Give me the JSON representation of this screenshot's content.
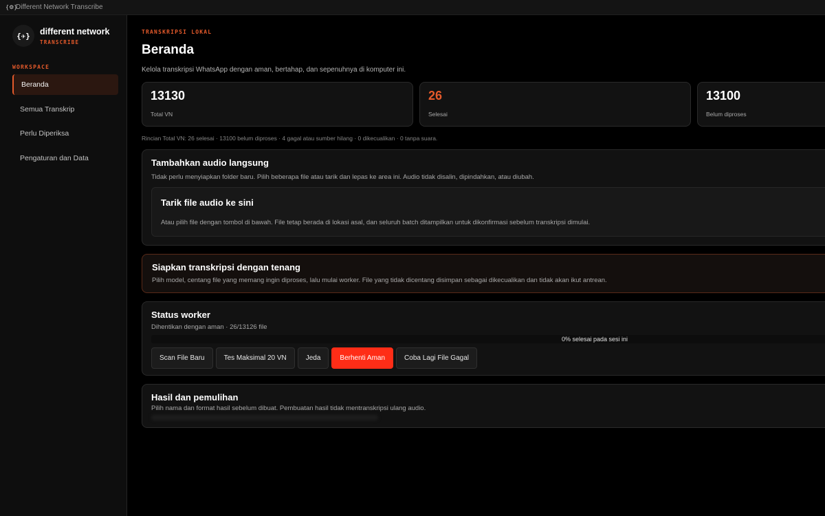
{
  "window": {
    "title": "Different Network Transcribe",
    "icon": "app-logo-icon"
  },
  "brand": {
    "logo_text": "{☀}",
    "name": "different network",
    "sub": "TRANSCRIBE"
  },
  "sidebar": {
    "section_label": "WORKSPACE",
    "items": [
      {
        "label": "Beranda",
        "active": true
      },
      {
        "label": "Semua Transkrip"
      },
      {
        "label": "Perlu Diperiksa"
      },
      {
        "label": "Pengaturan dan Data"
      }
    ]
  },
  "header": {
    "eyebrow": "TRANSKRIPSI LOKAL",
    "title": "Beranda",
    "subtitle": "Kelola transkripsi WhatsApp dengan aman, bertahap, dan sepenuhnya di komputer ini."
  },
  "stats": [
    {
      "value": "13130",
      "label": "Total VN"
    },
    {
      "value": "26",
      "label": "Selesai"
    },
    {
      "value": "13100",
      "label": "Belum diproses"
    }
  ],
  "breakdown": "Rincian Total VN: 26 selesai · 13100 belum diproses · 4 gagal atau sumber hilang · 0 dikecualikan · 0 tanpa suara.",
  "upload": {
    "title": "Tambahkan audio langsung",
    "desc": "Tidak perlu menyiapkan folder baru. Pilih beberapa file atau tarik dan lepas ke area ini. Audio tidak disalin, dipindahkan, atau diubah.",
    "drop_title": "Tarik file audio ke sini",
    "drop_desc": "Atau pilih file dengan tombol di bawah. File tetap berada di lokasi asal, dan seluruh batch ditampilkan untuk dikonfirmasi sebelum transkripsi dimulai."
  },
  "prep": {
    "title": "Siapkan transkripsi dengan tenang",
    "desc": "Pilih model, centang file yang memang ingin diproses, lalu mulai worker. File yang tidak dicentang disimpan sebagai dikecualikan dan tidak akan ikut antrean."
  },
  "worker": {
    "title": "Status worker",
    "status": "Dihentikan dengan aman · 26/13126 file",
    "progress_percent": 0,
    "progress_text": "0% selesai pada sesi ini",
    "buttons": [
      {
        "label": "Scan File Baru"
      },
      {
        "label": "Tes Maksimal 20 VN"
      },
      {
        "label": "Jeda"
      },
      {
        "label": "Berhenti Aman",
        "danger": true
      },
      {
        "label": "Coba Lagi File Gagal"
      }
    ]
  },
  "results": {
    "title": "Hasil dan pemulihan",
    "desc": "Pilih nama dan format hasil sebelum dibuat. Pembuatan hasil tidak mentranskripsi ulang audio."
  },
  "colors": {
    "accent": "#e55a2b",
    "danger": "#ff2d17",
    "background": "#000000",
    "card": "#121212"
  }
}
